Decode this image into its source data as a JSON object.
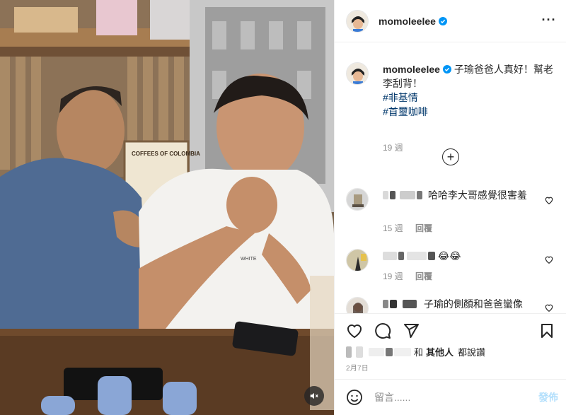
{
  "post": {
    "username": "momoleelee",
    "verified": true,
    "more_icon": "more-horizontal-icon",
    "caption": {
      "text": "子瑜爸爸人真好！幫老李刮背！",
      "hashtags": [
        "#非基情",
        "#首璽咖啡"
      ],
      "time": "19 週"
    },
    "load_more_icon": "plus-circle-icon",
    "comments": [
      {
        "text": "哈哈李大哥感覺很害羞",
        "time": "15 週",
        "reply": "回覆"
      },
      {
        "text": "😂😂",
        "time": "19 週",
        "reply": "回覆"
      },
      {
        "text": "子瑜的側顏和爸爸蠻像",
        "time": "",
        "reply": ""
      }
    ],
    "liked_by": {
      "suffix": "和",
      "others": "其他人",
      "verb": "都說讚"
    },
    "date": "2月7日",
    "add_comment": {
      "placeholder": "留言......",
      "post_label": "發佈",
      "emoji_icon": "smile-icon"
    },
    "action_icons": [
      "heart-icon",
      "comment-icon",
      "share-icon",
      "bookmark-icon"
    ],
    "video": {
      "mute_icon": "muted-speaker-icon",
      "sign_text": "COFFEES OF COLOMBIA",
      "shirt_text": "WHITE"
    },
    "colors": {
      "link": "#00376b",
      "post_button": "#b2dffc",
      "verified": "#0095f6",
      "secondary_text": "#8e8e8e"
    }
  }
}
